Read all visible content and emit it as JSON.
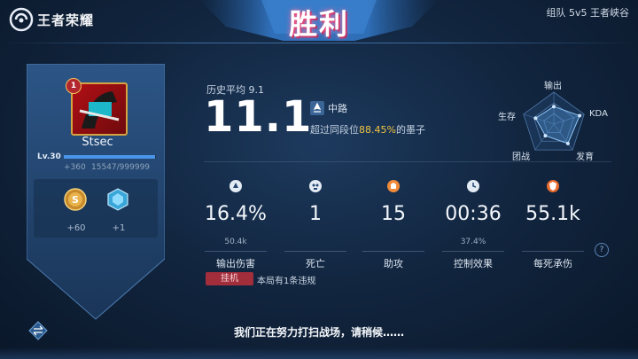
{
  "brand": {
    "name": "王者荣耀"
  },
  "header": {
    "result": "胜利",
    "mode": "组队 5v5 王者峡谷"
  },
  "player": {
    "rank_badge": "1",
    "name": "Stsec",
    "level": "Lv.30",
    "exp_gain": "+360",
    "exp_total": "15547/999999",
    "exp_fraction": 0.99
  },
  "rewards": [
    {
      "icon": "gold-coin-icon",
      "value": "+60"
    },
    {
      "icon": "crystal-icon",
      "value": "+1"
    }
  ],
  "score": {
    "history_avg": "历史平均 9.1",
    "rating": "11.1",
    "lane": "中路",
    "beat_prefix": "超过同段位",
    "beat_pct": "88.45%",
    "beat_suffix": "的墨子"
  },
  "radar": {
    "labels": [
      "输出",
      "KDA",
      "发育",
      "团战",
      "生存"
    ],
    "values": [
      0.55,
      0.85,
      0.75,
      0.45,
      0.6
    ]
  },
  "stats": [
    {
      "icon": "damage-icon",
      "value": "16.4%",
      "sub": "50.4k",
      "label": "输出伤害"
    },
    {
      "icon": "skull-icon",
      "value": "1",
      "sub": "",
      "label": "死亡"
    },
    {
      "icon": "assist-icon",
      "value": "15",
      "sub": "",
      "label": "助攻"
    },
    {
      "icon": "clock-icon",
      "value": "00:36",
      "sub": "37.4%",
      "label": "控制效果"
    },
    {
      "icon": "shield-icon",
      "value": "55.1k",
      "sub": "",
      "label": "每死承伤"
    }
  ],
  "afk": {
    "tag": "挂机",
    "text": "本局有1条违规"
  },
  "help": "?",
  "loading": "我们正在努力打扫战场，请稍候……",
  "colors": {
    "accent": "#4a95e8",
    "gold": "#f0c443",
    "warn": "#a22d3b"
  }
}
